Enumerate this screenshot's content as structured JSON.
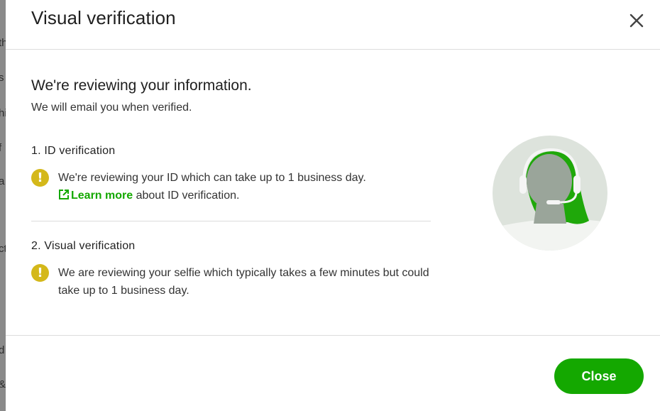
{
  "backdrop": {
    "fragments": [
      "th",
      "s",
      "hi",
      "f",
      "a",
      "ct",
      "d",
      "&"
    ]
  },
  "modal": {
    "title": "Visual verification",
    "close_icon": "close-icon",
    "heading": "We're reviewing your information.",
    "subheading": "We will email you when verified.",
    "steps": [
      {
        "title": "1. ID verification",
        "icon": "warning-icon",
        "text": "We're reviewing your ID which can take up to 1 business day.",
        "link_icon": "external-link-icon",
        "link_label": "Learn more",
        "link_suffix": " about ID verification."
      },
      {
        "title": "2. Visual verification",
        "icon": "warning-icon",
        "text": "We are reviewing your selfie which typically takes a few minutes but could take up to 1 business day."
      }
    ],
    "illustration": "support-agent-headset-icon",
    "close_button_label": "Close"
  },
  "colors": {
    "accent": "#14a800",
    "warning": "#d4b81a",
    "divider": "#dcdcdc"
  }
}
